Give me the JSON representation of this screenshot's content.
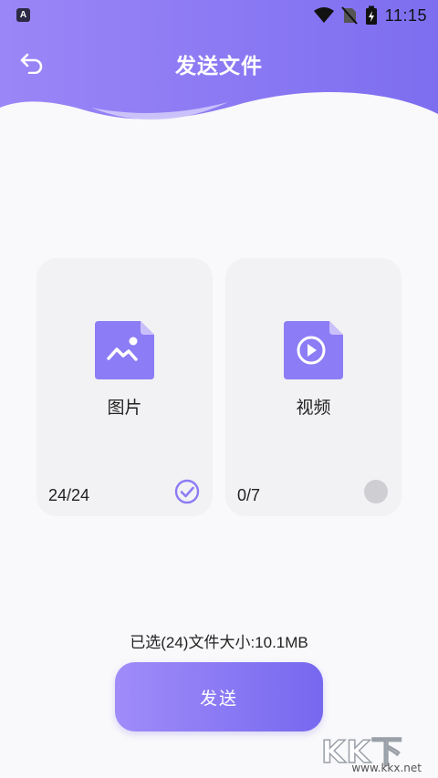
{
  "status_bar": {
    "app_badge": "A",
    "time": "11:15"
  },
  "header": {
    "title": "发送文件"
  },
  "cards": [
    {
      "label": "图片",
      "count": "24/24",
      "selected": true
    },
    {
      "label": "视频",
      "count": "0/7",
      "selected": false
    }
  ],
  "summary": "已选(24)文件大小:10.1MB",
  "send_button": "发送",
  "watermark": {
    "logo": "KK下载",
    "url": "www.kkx.net"
  },
  "colors": {
    "accent": "#8a78f5",
    "header_gradient_start": "#9a84f7",
    "header_gradient_end": "#7a6cf0"
  },
  "icons": {
    "back": "back-arrow-icon",
    "image_file": "image-file-icon",
    "video_file": "video-file-icon",
    "checked": "check-circle-icon",
    "unchecked": "empty-circle-icon"
  }
}
